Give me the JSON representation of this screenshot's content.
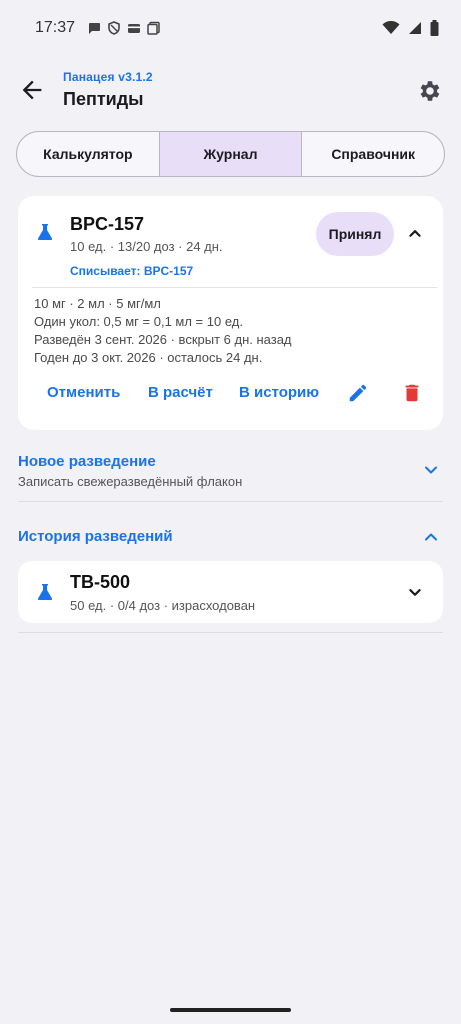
{
  "status_bar": {
    "time": "17:37",
    "left_icons": [
      "chat-bubble-icon",
      "shield-icon",
      "card-icon",
      "stack-icon"
    ],
    "right_icons": [
      "wifi-icon",
      "signal-icon",
      "battery-icon"
    ]
  },
  "app_bar": {
    "version": "Панацея v3.1.2",
    "title": "Пептиды"
  },
  "tabs": [
    {
      "label": "Калькулятор",
      "active": false
    },
    {
      "label": "Журнал",
      "active": true
    },
    {
      "label": "Справочник",
      "active": false
    }
  ],
  "active_vial": {
    "name": "BPC-157",
    "summary": "10 ед. · 13/20 доз · 24 дн.",
    "deducting": "Списывает: BPC-157",
    "status_button": "Принял",
    "details": [
      "10 мг · 2 мл · 5 мг/мл",
      "Один укол: 0,5 мг = 0,1 мл = 10 ед.",
      "Разведён 3 сент. 2026 · вскрыт 6 дн. назад",
      "Годен до 3 окт. 2026 · осталось 24 дн."
    ],
    "actions": {
      "cancel": "Отменить",
      "to_calc": "В расчёт",
      "to_history": "В историю"
    },
    "accent_color": "#1a73e8",
    "delete_color": "#e53935"
  },
  "new_dilution": {
    "title": "Новое разведение",
    "subtitle": "Записать свежеразведённый флакон"
  },
  "history": {
    "title": "История разведений",
    "items": [
      {
        "name": "TB-500",
        "summary": "50 ед. · 0/4 доз · израсходован"
      }
    ]
  }
}
